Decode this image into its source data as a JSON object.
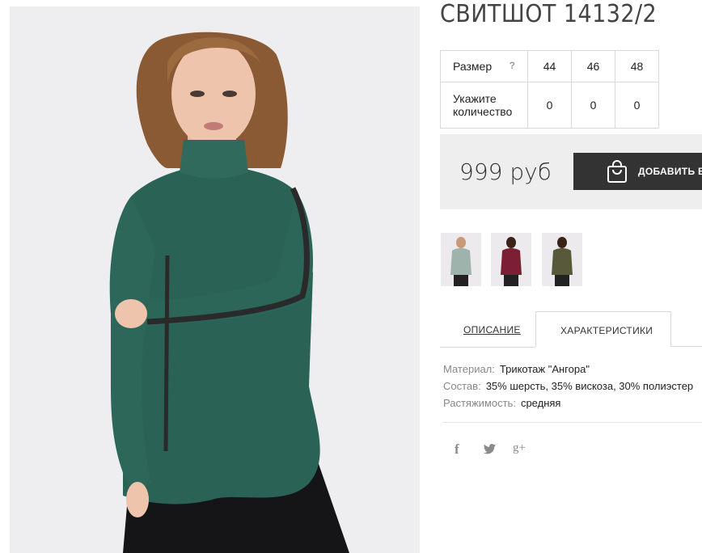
{
  "product": {
    "title": "СВИТШОТ 14132/2",
    "sizes": {
      "size_label": "Размер",
      "help": "?",
      "sizes": [
        "44",
        "46",
        "48"
      ],
      "qty_label_line1": "Укажите",
      "qty_label_line2": "количество",
      "quantities": [
        "0",
        "0",
        "0"
      ]
    },
    "price": "999 руб",
    "add_to_cart": "ДОБАВИТЬ В"
  },
  "thumbnails": [
    {
      "color": "#9eb3ab"
    },
    {
      "color": "#7c1e34"
    },
    {
      "color": "#58583a"
    }
  ],
  "tabs": {
    "description": "ОПИСАНИЕ",
    "characteristics": "ХАРАКТЕРИСТИКИ",
    "active": "characteristics"
  },
  "specs": [
    {
      "key": "Материал:",
      "value": "Трикотаж \"Ангора\""
    },
    {
      "key": "Состав:",
      "value": "35% шерсть, 35% вискоза, 30% полиэстер"
    },
    {
      "key": "Растяжимость:",
      "value": "средняя"
    }
  ],
  "social": {
    "facebook": "f",
    "twitter": "twitter-bird",
    "google_plus": "g+"
  },
  "colors": {
    "sweater": "#2a6356",
    "button": "#333333",
    "price_bg": "#eeeeee",
    "photo_bg": "#eeeef0"
  }
}
